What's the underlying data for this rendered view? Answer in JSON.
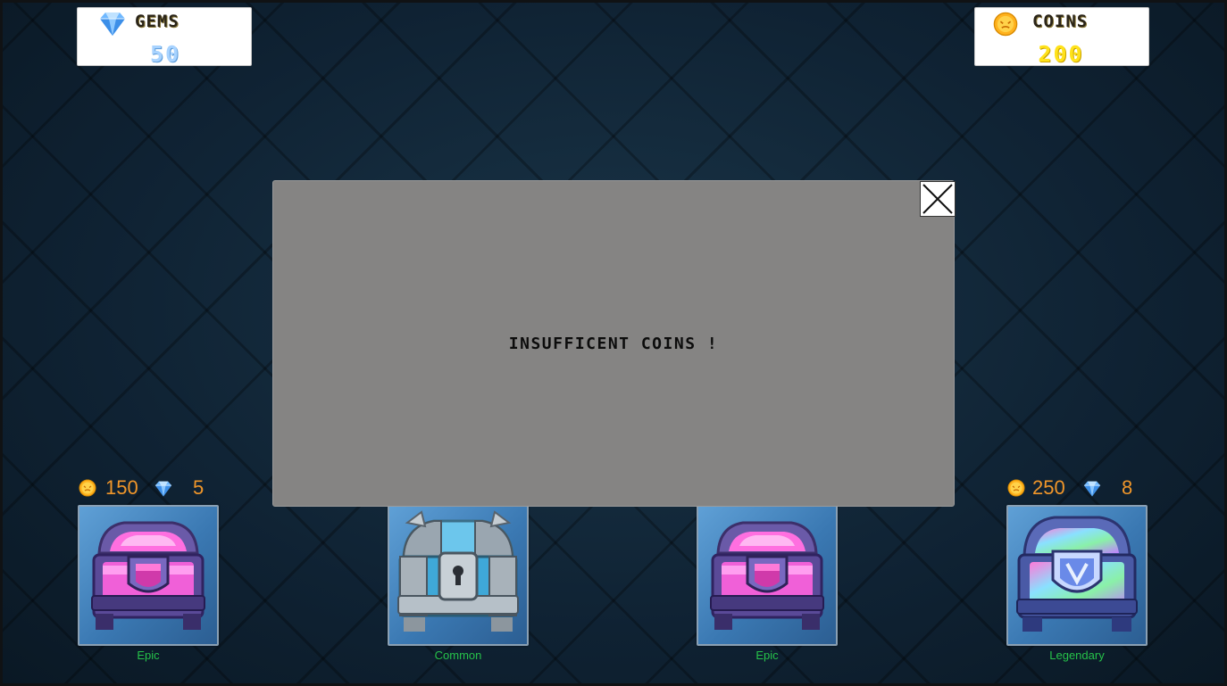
{
  "currency": {
    "gems": {
      "label": "GEMS",
      "value": "50",
      "icon": "diamond-icon"
    },
    "coins": {
      "label": "COINS",
      "value": "200",
      "icon": "coin-icon"
    }
  },
  "dialog": {
    "message": "INSUFFICENT COINS !",
    "close_icon": "close-icon"
  },
  "shop": {
    "chests": [
      {
        "name": "Epic",
        "coin_price": "150",
        "gem_price": "5",
        "color": "#e05ccf"
      },
      {
        "name": "Common",
        "color": "#46b4e0"
      },
      {
        "name": "Epic",
        "color": "#e05ccf"
      },
      {
        "name": "Legendary",
        "coin_price": "250",
        "gem_price": "8",
        "color": "#8a6fe0"
      }
    ]
  },
  "colors": {
    "price_text": "#f0962a",
    "chest_label": "#26c24a",
    "gems_value": "#a8d3ff",
    "coins_value": "#ffe21a",
    "modal_bg": "#858483"
  }
}
